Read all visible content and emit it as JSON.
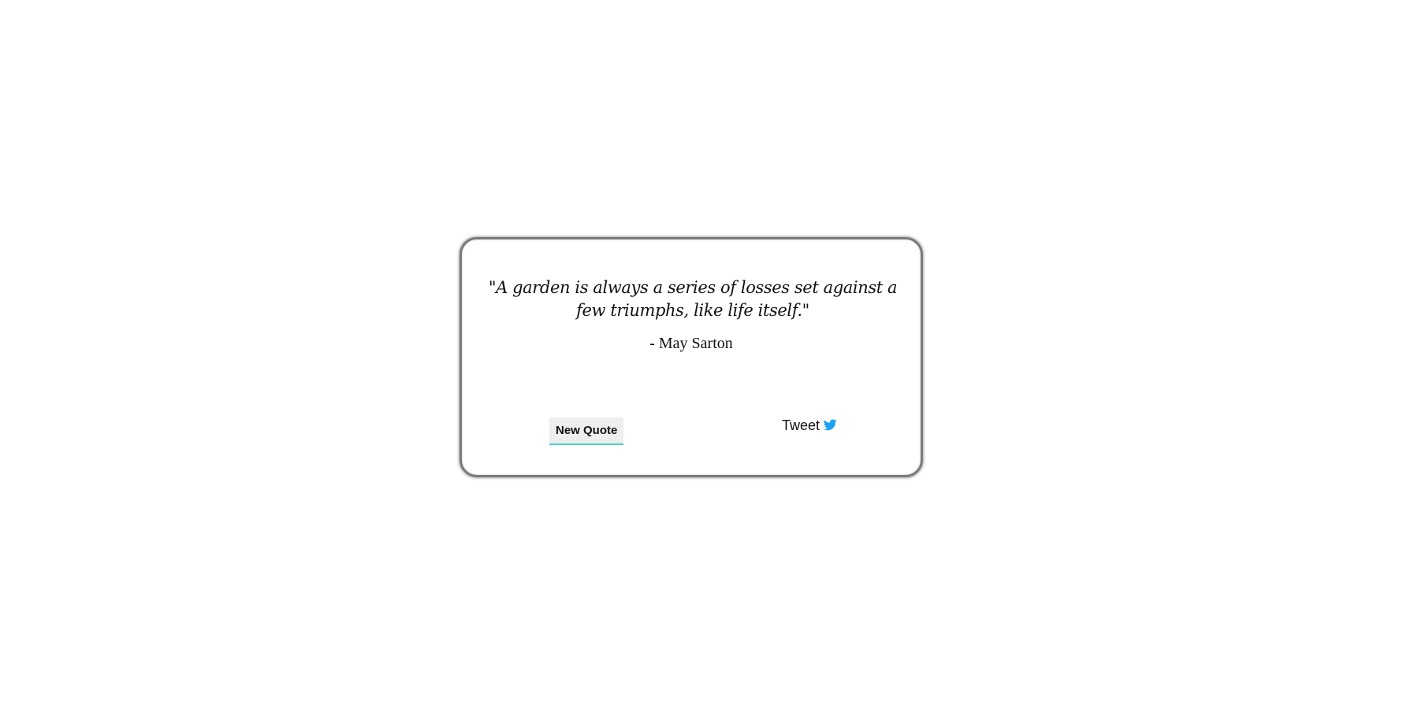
{
  "quote": {
    "text": "\"A garden is always a series of losses set against a few triumphs, like life itself.\"",
    "author": "- May Sarton"
  },
  "actions": {
    "new_quote_label": "New Quote",
    "tweet_label": "Tweet",
    "tweet_icon": "twitter-bird-icon",
    "tweet_icon_color": "#1da1f2",
    "button_accent_color": "#49d6c6"
  }
}
